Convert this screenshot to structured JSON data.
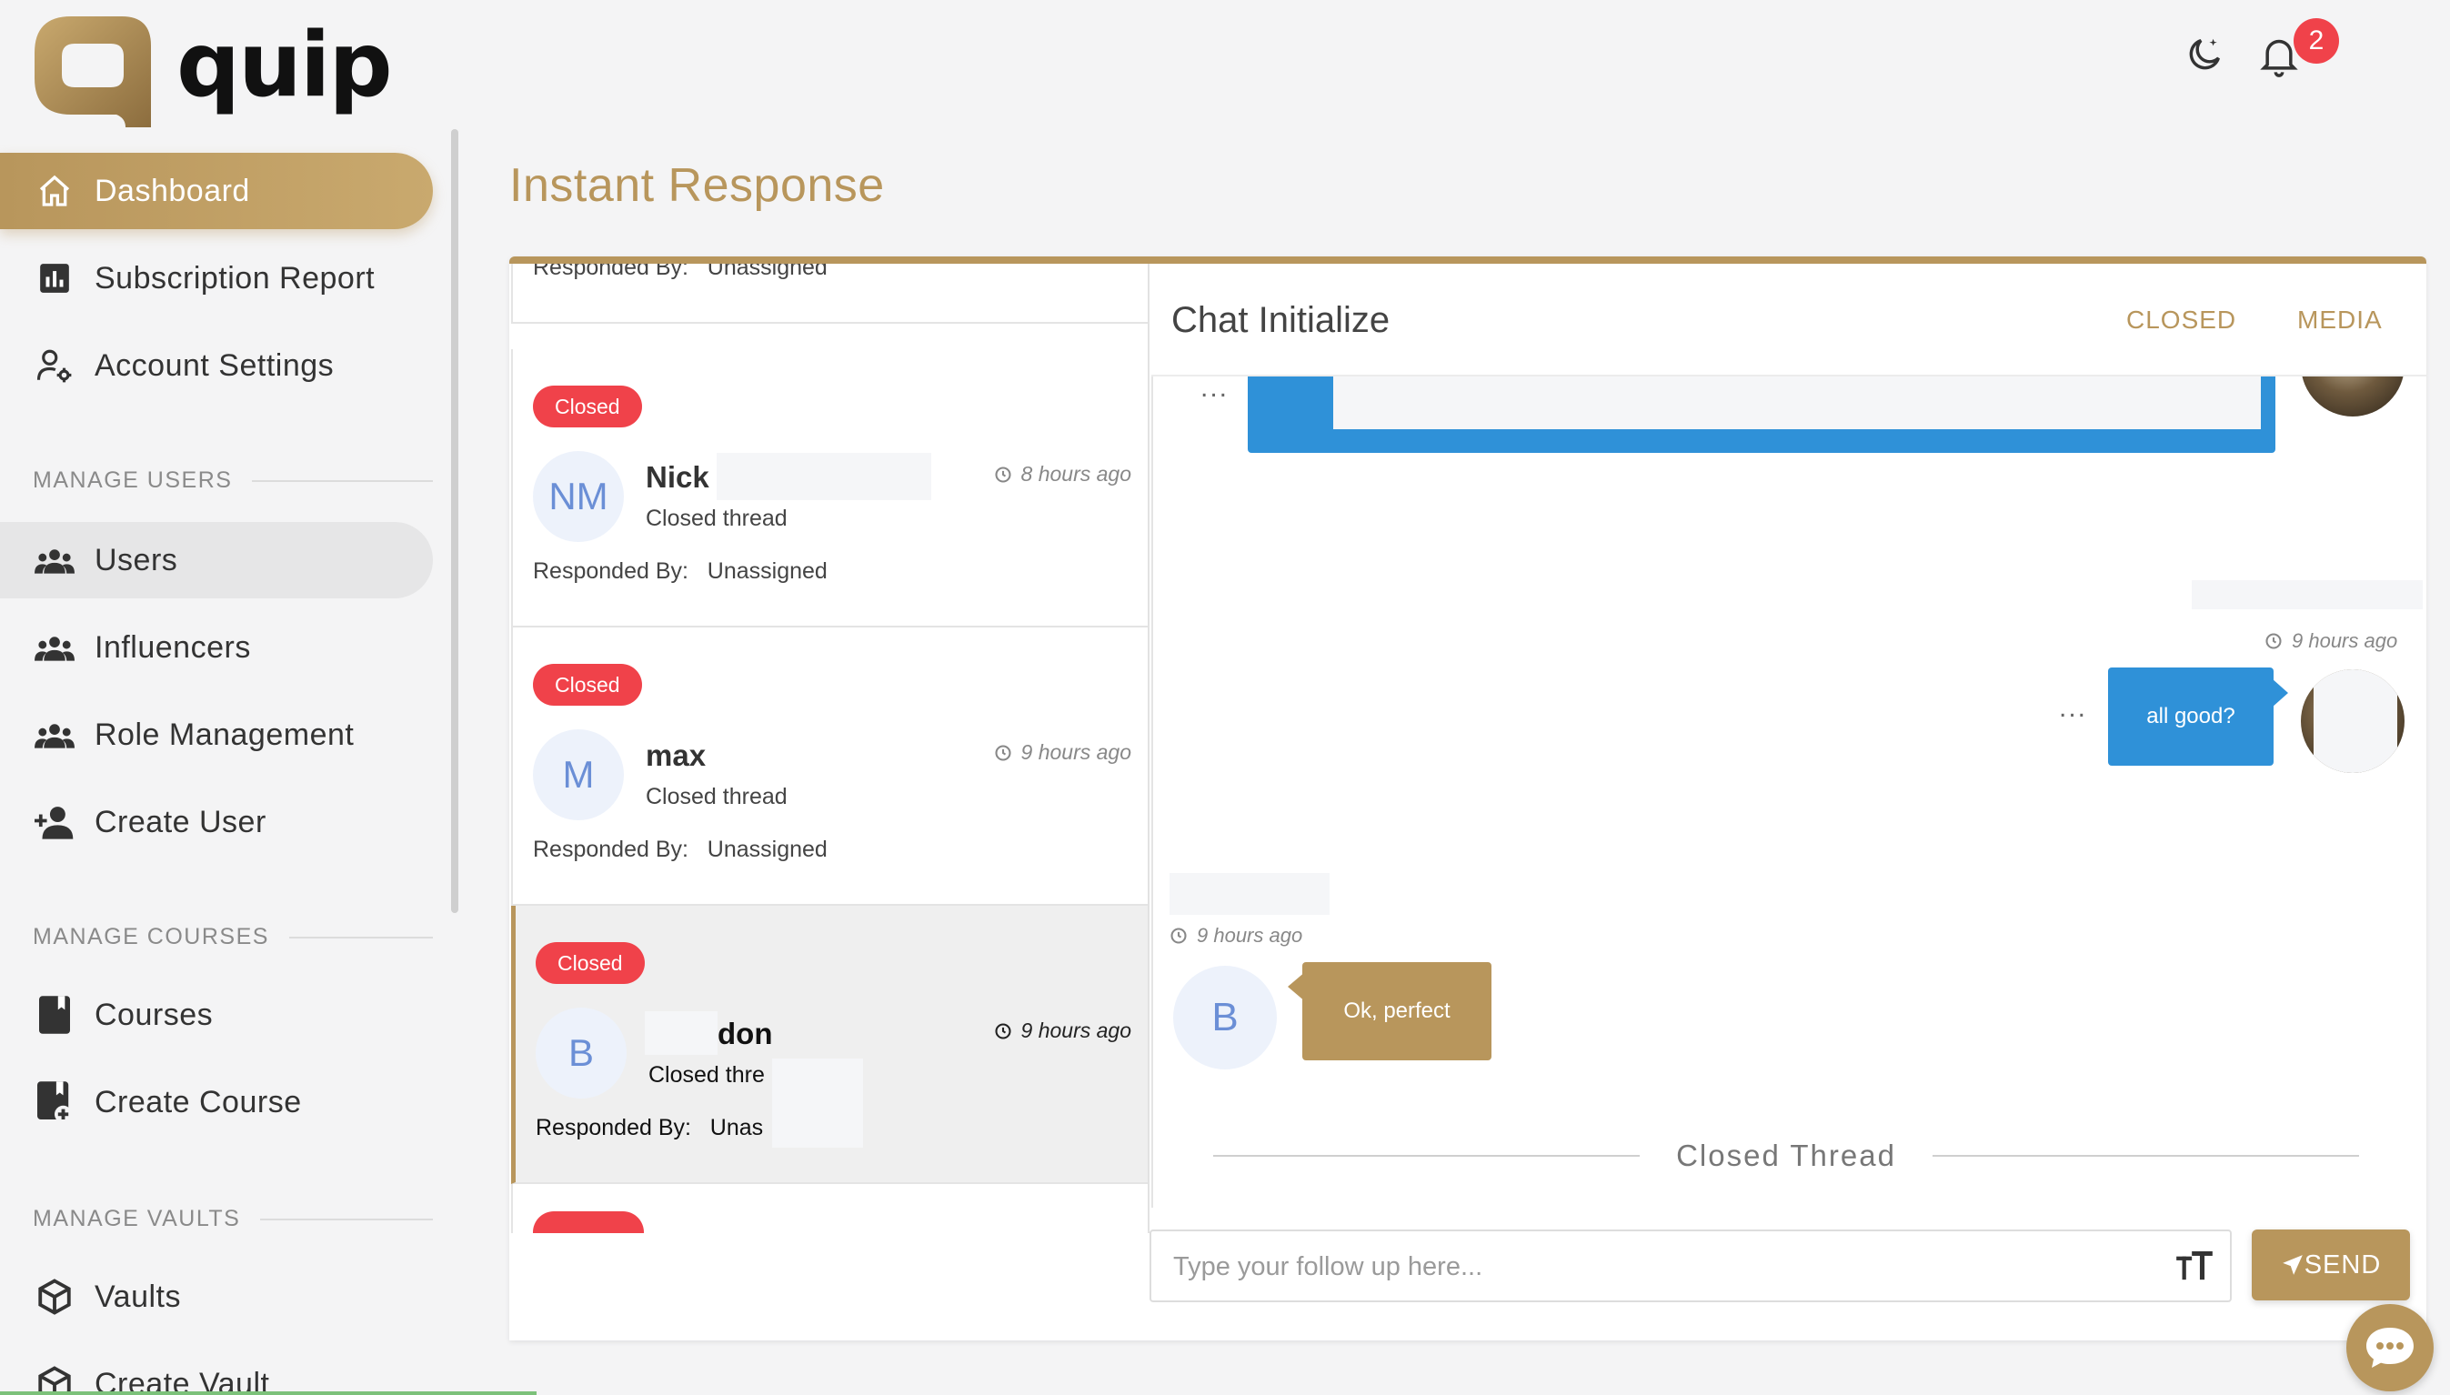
{
  "brand": {
    "name": "quip"
  },
  "colors": {
    "accent": "#b8965c",
    "danger": "#f0424a",
    "info": "#2f91d8",
    "avatar_text": "#6b8fd6"
  },
  "sidebar": {
    "items": [
      {
        "label": "Dashboard",
        "icon": "home-icon"
      },
      {
        "label": "Subscription Report",
        "icon": "bar-chart-icon"
      },
      {
        "label": "Account Settings",
        "icon": "user-gear-icon"
      },
      {
        "label": "Users",
        "icon": "group-icon"
      },
      {
        "label": "Influencers",
        "icon": "group-icon"
      },
      {
        "label": "Role Management",
        "icon": "group-icon"
      },
      {
        "label": "Create User",
        "icon": "add-user-icon"
      },
      {
        "label": "Courses",
        "icon": "book-icon"
      },
      {
        "label": "Create Course",
        "icon": "add-book-icon"
      },
      {
        "label": "Vaults",
        "icon": "cube-icon"
      },
      {
        "label": "Create Vault",
        "icon": "add-cube-icon"
      }
    ],
    "sections": [
      "MANAGE USERS",
      "MANAGE COURSES",
      "MANAGE VAULTS"
    ]
  },
  "header": {
    "notifications_count": "2"
  },
  "page": {
    "title": "Instant Response"
  },
  "threads": {
    "partial_top": {
      "responded_label": "Responded By:",
      "responded_value": "Unassigned"
    },
    "items": [
      {
        "status": "Closed",
        "initials": "NM",
        "name": "Nick",
        "subtitle": "Closed thread",
        "time": "8 hours ago",
        "responded_label": "Responded By:",
        "responded_value": "Unassigned"
      },
      {
        "status": "Closed",
        "initials": "M",
        "name": "max",
        "subtitle": "Closed thread",
        "time": "9 hours ago",
        "responded_label": "Responded By:",
        "responded_value": "Unassigned"
      },
      {
        "status": "Closed",
        "initials": "B",
        "name": "don",
        "subtitle": "Closed thre",
        "time": "9 hours ago",
        "responded_label": "Responded By:",
        "responded_value": "Unas"
      }
    ]
  },
  "chat": {
    "title": "Chat Initialize",
    "tabs": [
      "CLOSED",
      "MEDIA"
    ],
    "messages": [
      {
        "time": "9 hours ago",
        "text": "all good?"
      },
      {
        "time": "9 hours ago",
        "initial": "B",
        "text": "Ok, perfect"
      }
    ],
    "closed_label": "Closed Thread",
    "more_label": "..."
  },
  "composer": {
    "placeholder": "Type your follow up here...",
    "send_label": "SEND"
  }
}
